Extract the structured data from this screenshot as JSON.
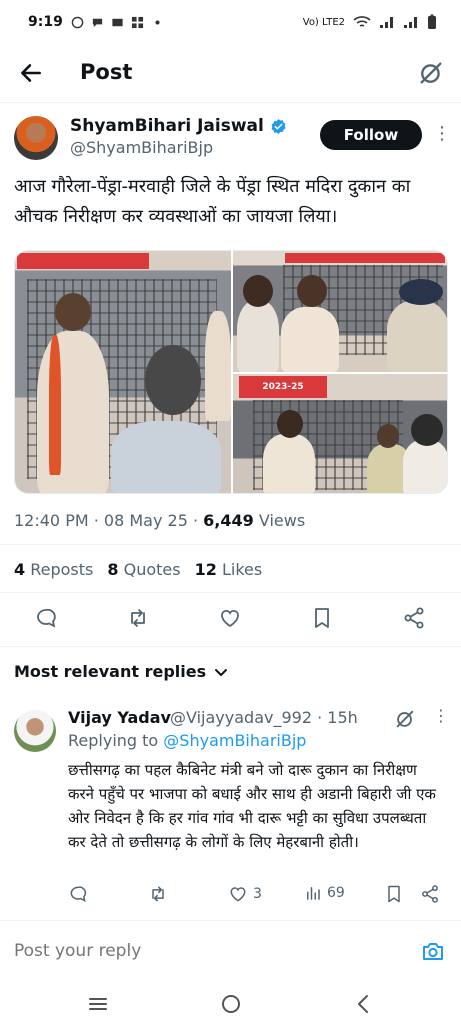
{
  "status": {
    "time": "9:19",
    "network": "Vo) LTE2"
  },
  "header": {
    "title": "Post"
  },
  "post": {
    "author_name": "ShyamBihari Jaiswal",
    "author_handle": "@ShyamBihariBjp",
    "follow_label": "Follow",
    "text": "आज गौरेला-पेंड्रा-मरवाही जिले के पेंड्रा स्थित मदिरा दुकान का औचक निरीक्षण कर व्यवस्थाओं का जायजा लिया।",
    "time": "12:40 PM",
    "date": "08 May 25",
    "views_count": "6,449",
    "views_label": "Views",
    "reposts_count": "4",
    "reposts_label": "Reposts",
    "quotes_count": "8",
    "quotes_label": "Quotes",
    "likes_count": "12",
    "likes_label": "Likes",
    "photo_signs": [
      "2023-25"
    ]
  },
  "replies": {
    "heading": "Most relevant replies",
    "items": [
      {
        "name": "Vijay Yadav",
        "handle": "@Vijayyadav_992",
        "age": "15h",
        "replying_prefix": "Replying to",
        "replying_to": "@ShyamBihariBjp",
        "text": "छत्तीसगढ़ का पहल कैबिनेट मंत्री बने जो दारू दुकान का निरीक्षण करने पहुँचे पर भाजपा को बधाई और साथ ही अडानी बिहारी जी एक ओर निवेदन है कि हर गांव गांव भी दारू भट्टी का सुविधा उपलब्धता कर देते तो छत्तीसगढ़ के लोगों के लिए मेहरबानी होती।",
        "likes": "3",
        "views": "69"
      }
    ]
  },
  "composer": {
    "placeholder": "Post your reply"
  },
  "colors": {
    "accent": "#1d9bf0",
    "text": "#0f1419",
    "muted": "#536471"
  }
}
